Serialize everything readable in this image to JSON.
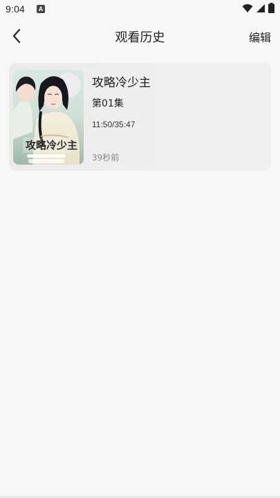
{
  "status_bar": {
    "time": "9:04",
    "app_icon_letter": "A",
    "icons": [
      "wifi-icon",
      "signal-icon",
      "battery-icon"
    ]
  },
  "header": {
    "back_icon": "chevron-left-icon",
    "title": "观看历史",
    "edit_label": "编辑"
  },
  "history": {
    "items": [
      {
        "title": "攻略冷少主",
        "episode": "第01集",
        "progress": "11:50/35:47",
        "time_ago": "39秒前",
        "poster_art_text": "攻略冷少主"
      }
    ]
  },
  "colors": {
    "background": "#f7f7f7",
    "card": "#ececec",
    "muted_text": "#888888"
  }
}
